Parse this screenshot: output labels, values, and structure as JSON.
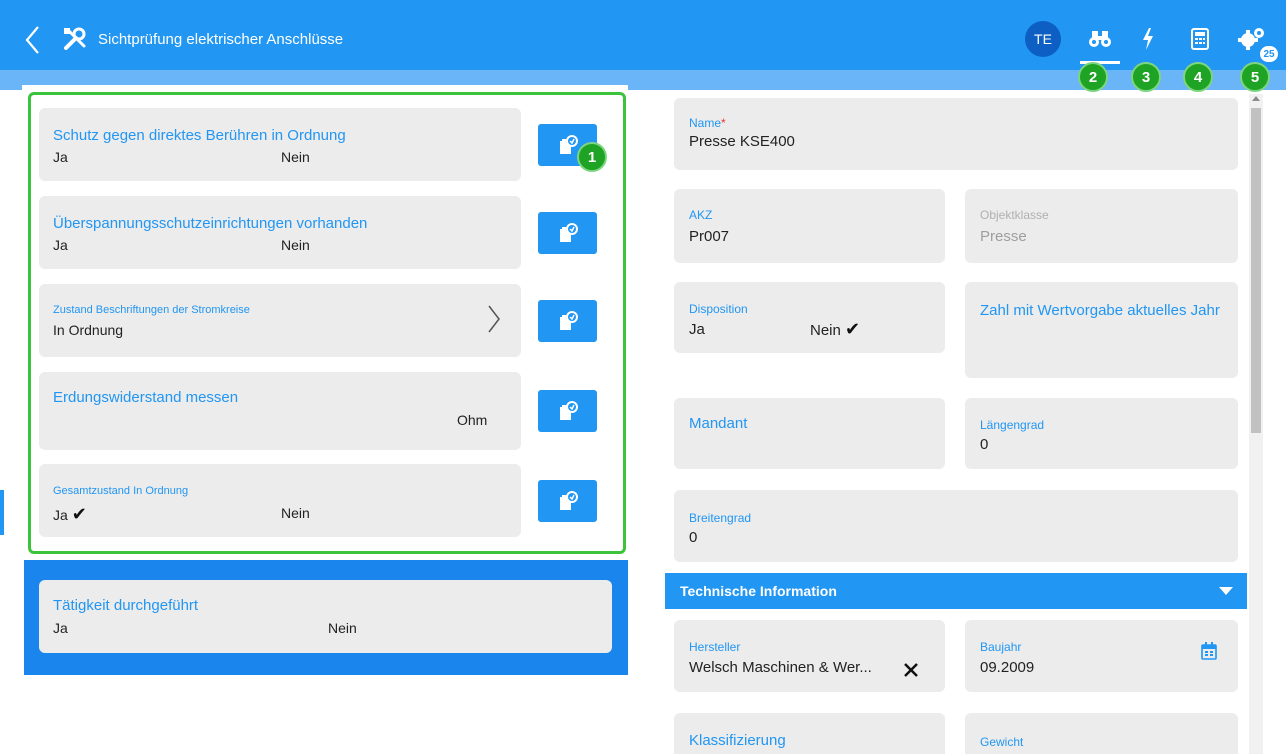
{
  "header": {
    "title": "Sichtprüfung elektrischer Anschlüsse",
    "avatar_initials": "TE",
    "notification_count": "25",
    "icons": [
      "binoculars-icon",
      "lightning-icon",
      "calculator-icon",
      "gears-icon"
    ]
  },
  "markers": [
    "1",
    "2",
    "3",
    "4",
    "5"
  ],
  "checklist": [
    {
      "title": "Schutz gegen direktes Berühren in Ordnung",
      "yes": "Ja",
      "no": "Nein",
      "selected": ""
    },
    {
      "title": "Überspannungsschutzeinrichtungen vorhanden",
      "yes": "Ja",
      "no": "Nein",
      "selected": ""
    },
    {
      "title": "Zustand Beschriftungen der Stromkreise",
      "value": "In Ordnung"
    },
    {
      "title": "Erdungswiderstand messen",
      "unit": "Ohm"
    },
    {
      "title": "Gesamtzustand In Ordnung",
      "yes": "Ja",
      "no": "Nein",
      "selected": "Ja"
    }
  ],
  "activity": {
    "title": "Tätigkeit durchgeführt",
    "yes": "Ja",
    "no": "Nein"
  },
  "details": {
    "name_label": "Name",
    "name_value": "Presse KSE400",
    "akz_label": "AKZ",
    "akz_value": "Pr007",
    "objektklasse_label": "Objektklasse",
    "objektklasse_value": "Presse",
    "disposition_label": "Disposition",
    "disposition_yes": "Ja",
    "disposition_no": "Nein",
    "disposition_selected": "Nein",
    "zahl_label": "Zahl mit Wertvorgabe aktuelles Jahr",
    "mandant_label": "Mandant",
    "laengengrad_label": "Längengrad",
    "laengengrad_value": "0",
    "breitengrad_label": "Breitengrad",
    "breitengrad_value": "0"
  },
  "technical": {
    "section_title": "Technische Information",
    "hersteller_label": "Hersteller",
    "hersteller_value": "Welsch Maschinen & Wer...",
    "baujahr_label": "Baujahr",
    "baujahr_value": "09.2009",
    "klassifizierung_label": "Klassifizierung",
    "gewicht_label": "Gewicht"
  },
  "colors": {
    "primary": "#2196f3",
    "marker": "#1fa324",
    "frame": "#3bc43b"
  }
}
